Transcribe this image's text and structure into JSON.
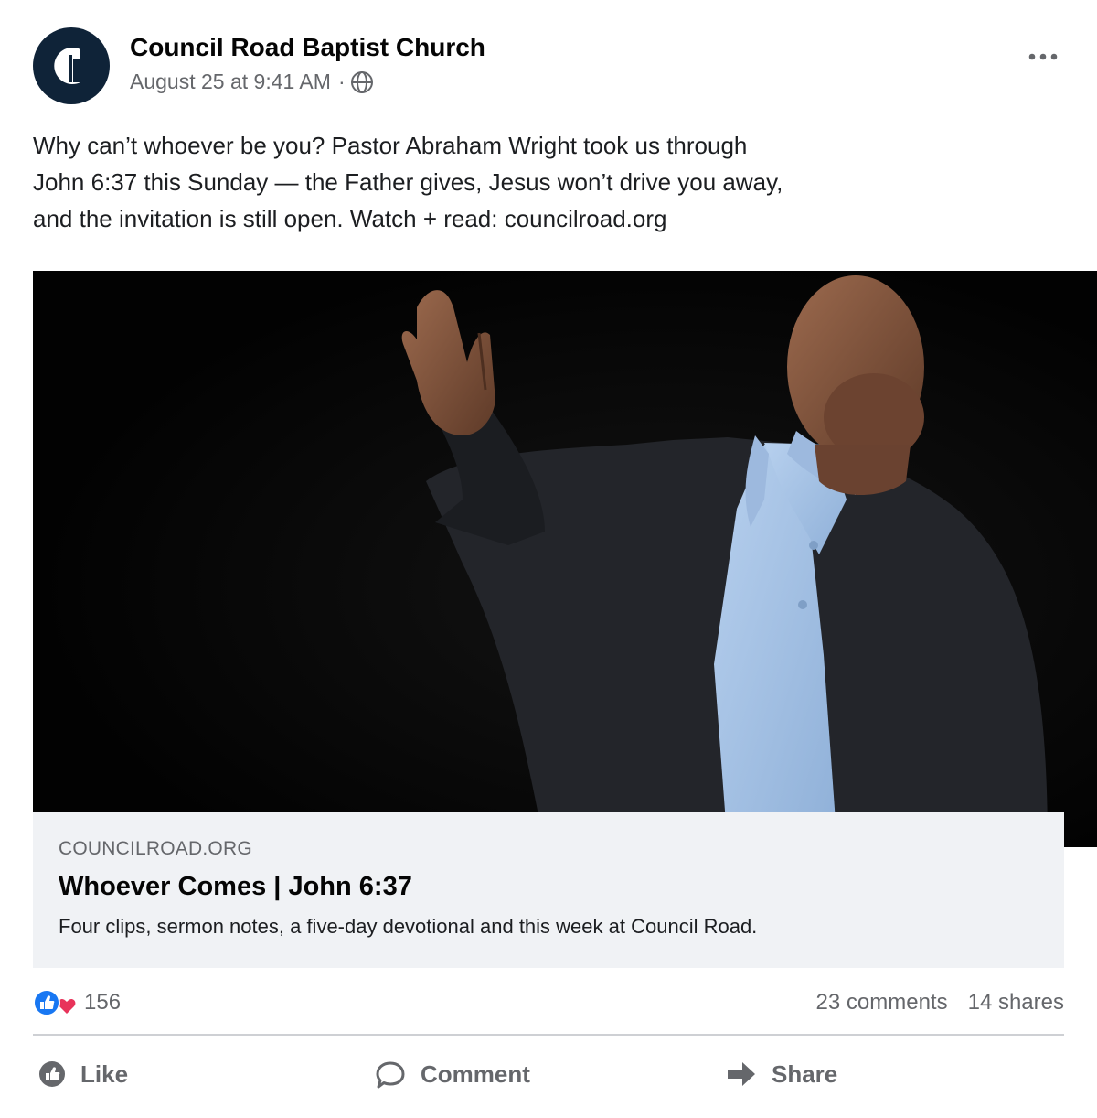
{
  "post": {
    "page_name": "Council Road Baptist Church",
    "timestamp": "August 25 at 9:41 AM",
    "separator": "·",
    "privacy_icon": "globe-icon",
    "more_icon": "more-dots-icon",
    "text_lines": [
      "Why can’t whoever be you? Pastor Abraham Wright took us through",
      "John 6:37 this Sunday — the Father gives, Jesus won’t drive you away,",
      "and the invitation is still open. Watch + read: councilroad.org"
    ]
  },
  "link_card": {
    "domain": "COUNCILROAD.ORG",
    "title": "Whoever Comes | John 6:37",
    "description": "Four clips, sermon notes, a five-day devotional and this week at Council Road."
  },
  "stats": {
    "reaction_count": "156",
    "comments": "23 comments",
    "shares": "14 shares"
  },
  "actions": {
    "like_label": "Like",
    "comment_label": "Comment",
    "share_label": "Share"
  },
  "colors": {
    "avatar_bg": "#0f2338",
    "like_blue": "#1877f2",
    "love_pink": "#e8335a",
    "secondary_text": "#65676b",
    "card_bg": "#f0f2f5"
  }
}
